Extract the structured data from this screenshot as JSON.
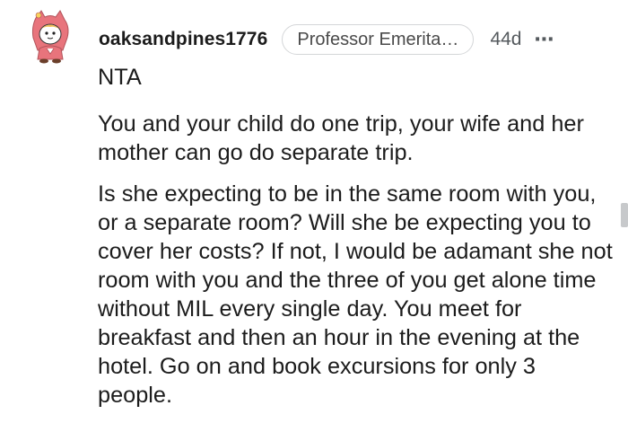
{
  "comment": {
    "username": "oaksandpines1776",
    "flair": "Professor Emerita…",
    "age": "44d",
    "more_icon": "⋯",
    "avatar_icon": "snoo-avatar-icon",
    "paragraphs": [
      "NTA",
      "You and your child do one trip, your wife and her mother can go do separate trip.",
      "Is she expecting to be in the same room with you, or a separate room? Will she be expecting you to cover her costs? If not, I would be adamant she not room with you and the three of you get alone time without MIL every single day. You meet for breakfast and then an hour in the evening at the hotel. Go on and book excursions for only 3 people."
    ]
  },
  "colors": {
    "text": "#1c1c1c",
    "meta": "#555a5e",
    "flair_border": "#d4d6d8",
    "avatar_hood": "#e8747c",
    "scrollbar": "#c7c9cb"
  }
}
